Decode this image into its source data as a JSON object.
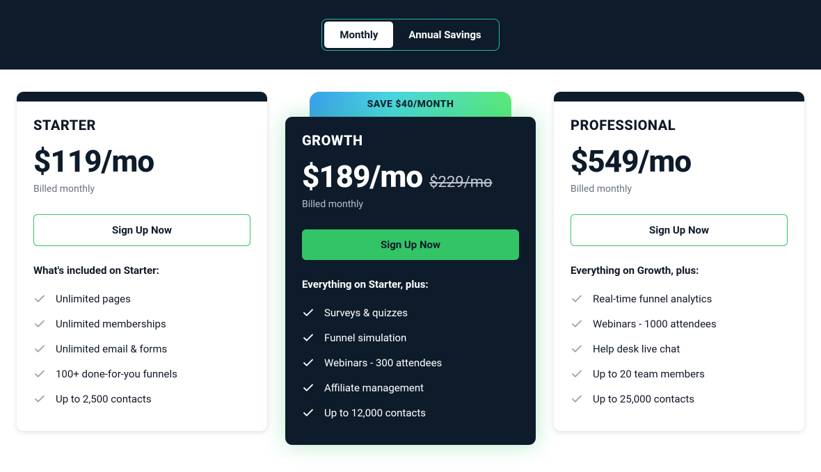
{
  "toggle": {
    "monthly": "Monthly",
    "annual": "Annual Savings"
  },
  "save_ribbon": "SAVE $40/MONTH",
  "signup_label": "Sign Up Now",
  "plans": {
    "starter": {
      "name": "STARTER",
      "price": "$119/mo",
      "billed": "Billed monthly",
      "included_heading": "What's included on Starter:",
      "features": [
        "Unlimited pages",
        "Unlimited memberships",
        "Unlimited email & forms",
        "100+ done-for-you funnels",
        "Up to 2,500 contacts"
      ]
    },
    "growth": {
      "name": "GROWTH",
      "price": "$189/mo",
      "old_price": "$229/mo",
      "billed": "Billed monthly",
      "included_heading": "Everything on Starter, plus:",
      "features": [
        "Surveys & quizzes",
        "Funnel simulation",
        "Webinars - 300 attendees",
        "Affiliate management",
        "Up to 12,000 contacts"
      ]
    },
    "professional": {
      "name": "PROFESSIONAL",
      "price": "$549/mo",
      "billed": "Billed monthly",
      "included_heading": "Everything on Growth, plus:",
      "features": [
        "Real-time funnel analytics",
        "Webinars - 1000 attendees",
        "Help desk live chat",
        "Up to 20 team members",
        "Up to 25,000 contacts"
      ]
    }
  }
}
